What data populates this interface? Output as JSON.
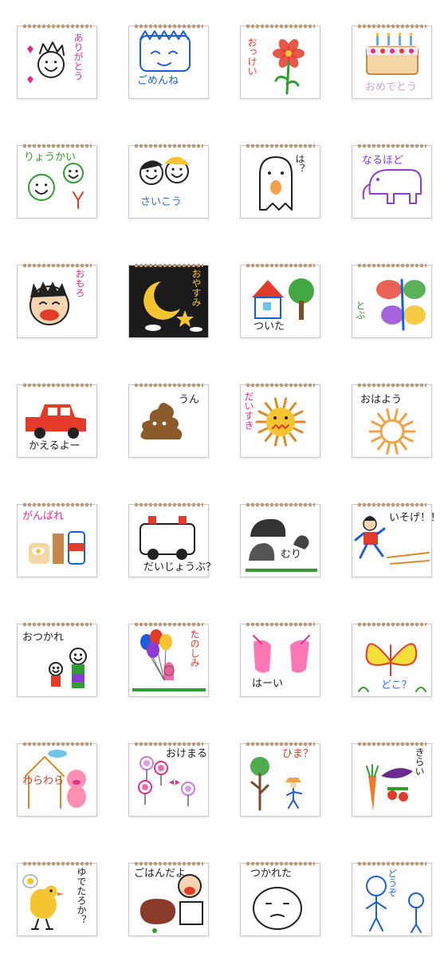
{
  "stickers": [
    {
      "id": "arigatou",
      "text": "ありがとう",
      "color": "#e0308a",
      "bg": "#ffffff",
      "motif": "smiling-face",
      "vertical": true
    },
    {
      "id": "gomennne",
      "text": "ごめんね",
      "color": "#1c5ed6",
      "bg": "#ffffff",
      "motif": "crying-face",
      "vertical": false
    },
    {
      "id": "okkei",
      "text": "おっけい",
      "color": "#e23b2a",
      "bg": "#ffffff",
      "motif": "red-flower",
      "vertical": true
    },
    {
      "id": "omedetou",
      "text": "おめでとう",
      "color": "#c9a7d9",
      "bg": "#ffffff",
      "motif": "birthday-cake",
      "vertical": false
    },
    {
      "id": "ryoukai",
      "text": "りょうかい",
      "color": "#2f9e2f",
      "bg": "#ffffff",
      "motif": "green-faces",
      "vertical": false
    },
    {
      "id": "saikou",
      "text": "さいこう",
      "color": "#2f6fe0",
      "bg": "#ffffff",
      "motif": "two-faces",
      "vertical": false
    },
    {
      "id": "ha",
      "text": "は？",
      "color": "#222222",
      "bg": "#ffffff",
      "motif": "ghost-face",
      "vertical": true
    },
    {
      "id": "naruhodo",
      "text": "なるほど",
      "color": "#8e3bd1",
      "bg": "#ffffff",
      "motif": "purple-elephant",
      "vertical": false
    },
    {
      "id": "omoro",
      "text": "おもろ",
      "color": "#e0308a",
      "bg": "#ffffff",
      "motif": "laughing-face",
      "vertical": true
    },
    {
      "id": "oyasumi",
      "text": "おやすみ",
      "color": "#f4c531",
      "bg": "#1b1b1b",
      "motif": "moon-night",
      "vertical": true
    },
    {
      "id": "tsuita",
      "text": "ついた",
      "color": "#222222",
      "bg": "#ffffff",
      "motif": "house-tree",
      "vertical": false
    },
    {
      "id": "tobu",
      "text": "とぶ",
      "color": "#2f9e2f",
      "bg": "#ffffff",
      "motif": "butterfly-wings",
      "vertical": true
    },
    {
      "id": "kaeruyo",
      "text": "かえるよー",
      "color": "#222222",
      "bg": "#ffffff",
      "motif": "red-car",
      "vertical": false
    },
    {
      "id": "un",
      "text": "うん",
      "color": "#222222",
      "bg": "#ffffff",
      "motif": "poop",
      "vertical": false
    },
    {
      "id": "daisuki",
      "text": "だいすき",
      "color": "#e0308a",
      "bg": "#ffffff",
      "motif": "lion-sun",
      "vertical": true
    },
    {
      "id": "ohayou",
      "text": "おはよう",
      "color": "#222222",
      "bg": "#ffffff",
      "motif": "sun",
      "vertical": false
    },
    {
      "id": "ganbare",
      "text": "がんばれ",
      "color": "#e0308a",
      "bg": "#ffffff",
      "motif": "bread-milk",
      "vertical": false
    },
    {
      "id": "daijoubu",
      "text": "だいじょうぶ？",
      "color": "#222222",
      "bg": "#ffffff",
      "motif": "ambulance",
      "vertical": false
    },
    {
      "id": "muri",
      "text": "むり",
      "color": "#222222",
      "bg": "#ffffff",
      "motif": "rocks",
      "vertical": false
    },
    {
      "id": "isoge",
      "text": "いそげ！！",
      "color": "#222222",
      "bg": "#ffffff",
      "motif": "running-boy",
      "vertical": false
    },
    {
      "id": "otsukare",
      "text": "おつかれ",
      "color": "#222222",
      "bg": "#ffffff",
      "motif": "family",
      "vertical": false
    },
    {
      "id": "tanoshimi",
      "text": "たのしみ",
      "color": "#e23b2a",
      "bg": "#ffffff",
      "motif": "balloons",
      "vertical": true
    },
    {
      "id": "haai",
      "text": "はーい",
      "color": "#222222",
      "bg": "#ffffff",
      "motif": "raised-hands",
      "vertical": false
    },
    {
      "id": "doko",
      "text": "どこ？",
      "color": "#2f6fe0",
      "bg": "#ffffff",
      "motif": "yellow-butterfly",
      "vertical": false
    },
    {
      "id": "warawara",
      "text": "わらわら",
      "color": "#e23b2a",
      "bg": "#ffffff",
      "motif": "pig-house",
      "vertical": false
    },
    {
      "id": "okemaru",
      "text": "おけまる",
      "color": "#222222",
      "bg": "#ffffff",
      "motif": "candies",
      "vertical": false
    },
    {
      "id": "hima",
      "text": "ひま？",
      "color": "#e23b2a",
      "bg": "#ffffff",
      "motif": "farmer-tree",
      "vertical": false
    },
    {
      "id": "kirai",
      "text": "きらい",
      "color": "#222222",
      "bg": "#ffffff",
      "motif": "vegetables",
      "vertical": true
    },
    {
      "id": "yudetaroka",
      "text": "ゆでたろか？",
      "color": "#222222",
      "bg": "#ffffff",
      "motif": "chick-egg",
      "vertical": true
    },
    {
      "id": "gohandayo",
      "text": "ごはんだよ",
      "color": "#222222",
      "bg": "#ffffff",
      "motif": "meat-chef",
      "vertical": false
    },
    {
      "id": "tsukareta",
      "text": "つかれた",
      "color": "#222222",
      "bg": "#ffffff",
      "motif": "tired-face",
      "vertical": false
    },
    {
      "id": "doudesu",
      "text": "どうぞ",
      "color": "#2f6fe0",
      "bg": "#ffffff",
      "motif": "two-people",
      "vertical": true
    }
  ]
}
